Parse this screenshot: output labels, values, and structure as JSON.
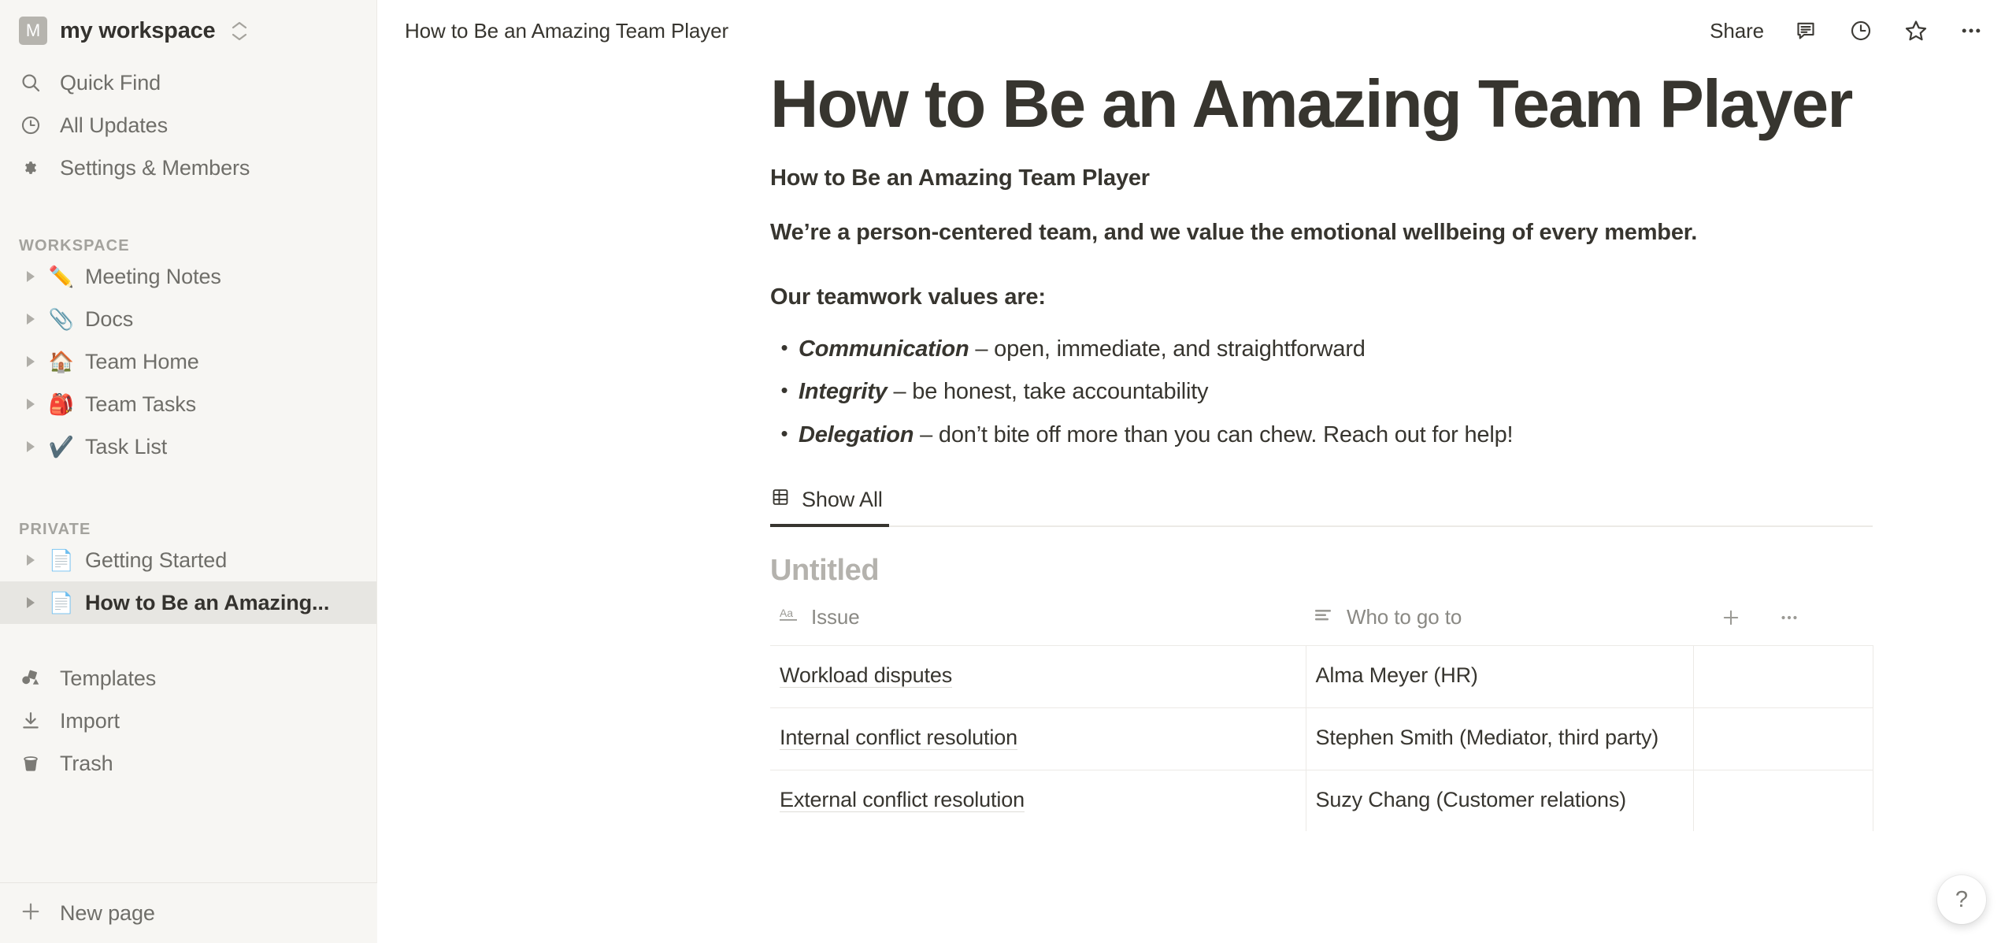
{
  "sidebar": {
    "workspace": {
      "avatar_letter": "M",
      "name": "my workspace",
      "switcher_icon": "chevron-updown-icon"
    },
    "nav": [
      {
        "label": "Quick Find",
        "icon": "search-icon"
      },
      {
        "label": "All Updates",
        "icon": "clock-icon"
      },
      {
        "label": "Settings & Members",
        "icon": "gear-icon"
      }
    ],
    "workspace_section": {
      "title": "WORKSPACE",
      "pages": [
        {
          "label": "Meeting Notes",
          "emoji": "✏️"
        },
        {
          "label": "Docs",
          "emoji": "📎"
        },
        {
          "label": "Team Home",
          "emoji": "🏠"
        },
        {
          "label": "Team Tasks",
          "emoji": "🎒"
        },
        {
          "label": "Task List",
          "emoji": "✔️"
        }
      ]
    },
    "private_section": {
      "title": "PRIVATE",
      "pages": [
        {
          "label": "Getting Started",
          "emoji": "📄",
          "selected": false
        },
        {
          "label": "How to Be an Amazing...",
          "emoji": "📄",
          "selected": true
        }
      ]
    },
    "bottom": [
      {
        "label": "Templates",
        "icon": "templates-icon"
      },
      {
        "label": "Import",
        "icon": "import-download-icon"
      },
      {
        "label": "Trash",
        "icon": "trash-icon"
      }
    ],
    "footer": {
      "label": "New page",
      "icon": "plus-icon"
    }
  },
  "topbar": {
    "breadcrumb": "How to Be an Amazing Team Player",
    "share_label": "Share",
    "icons": [
      "comment-icon",
      "clock-history-icon",
      "star-icon",
      "ellipsis-icon"
    ]
  },
  "document": {
    "title": "How to Be an Amazing Team Player",
    "subtitle": "How to Be an Amazing Team Player",
    "intro": "We’re a person-centered team, and we value the emotional wellbeing of every member.",
    "values_heading": "Our teamwork values are:",
    "values": [
      {
        "term": "Communication",
        "dash": " – ",
        "description": "open, immediate, and straightforward"
      },
      {
        "term": "Integrity",
        "dash": " – ",
        "description": "be honest, take accountability"
      },
      {
        "term": "Delegation",
        "dash": " – ",
        "description": "don’t bite off more than you can chew. Reach out for help!"
      }
    ]
  },
  "database": {
    "tabs": [
      {
        "label": "Show All",
        "icon": "table-grid-icon",
        "active": true
      }
    ],
    "title": "Untitled",
    "columns": [
      {
        "label": "Issue",
        "icon": "text-aa-icon"
      },
      {
        "label": "Who to go to",
        "icon": "text-lines-icon"
      }
    ],
    "actions": {
      "add_icon": "plus-icon",
      "more_icon": "ellipsis-icon"
    },
    "rows": [
      {
        "issue": "Workload disputes",
        "who": "Alma Meyer (HR)"
      },
      {
        "issue": "Internal conflict resolution",
        "who": "Stephen Smith (Mediator, third party)"
      },
      {
        "issue": "External conflict resolution",
        "who": "Suzy Chang (Customer relations)"
      }
    ]
  },
  "help": {
    "label": "?"
  },
  "colors": {
    "sidebar_bg": "#f7f6f3",
    "selected_bg": "#e7e6e2",
    "text": "#37352f",
    "muted": "#6f6e69"
  }
}
